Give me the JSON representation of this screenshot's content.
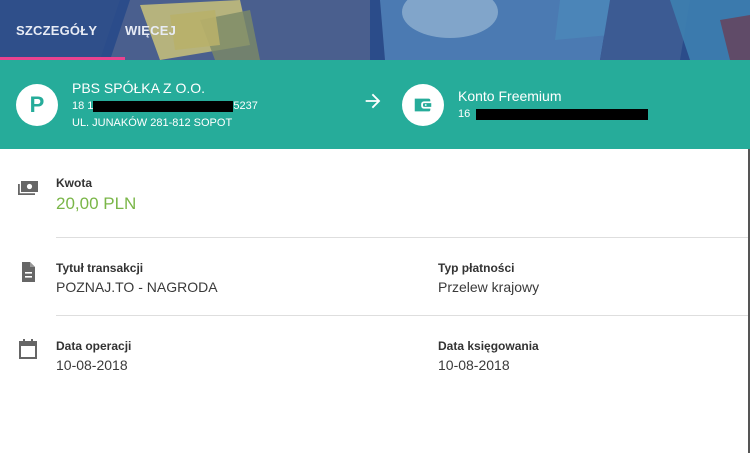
{
  "tabs": [
    {
      "label": "SZCZEGÓŁY",
      "active": true
    },
    {
      "label": "WIĘCEJ",
      "active": false
    }
  ],
  "transfer": {
    "from": {
      "avatar_letter": "P",
      "name": "PBS SPÓŁKA Z O.O.",
      "account_prefix": "18 1",
      "account_suffix": "5237",
      "address": "UL. JUNAKÓW 281-812 SOPOT"
    },
    "to": {
      "name": "Konto Freemium",
      "account_prefix": "16",
      "icon": "wallet-icon"
    },
    "arrow_icon": "arrow-right-icon"
  },
  "details": {
    "amount": {
      "label": "Kwota",
      "value": "20,00 PLN",
      "icon": "money-icon"
    },
    "title": {
      "label": "Tytuł transakcji",
      "value": "POZNAJ.TO - NAGRODA",
      "icon": "document-icon"
    },
    "payment_type": {
      "label": "Typ płatności",
      "value": "Przelew krajowy"
    },
    "operation_date": {
      "label": "Data operacji",
      "value": "10-08-2018",
      "icon": "calendar-icon"
    },
    "posting_date": {
      "label": "Data księgowania",
      "value": "10-08-2018"
    }
  },
  "colors": {
    "banner": "#2a4a86",
    "teal": "#26ac9a",
    "tab_indicator": "#e9438f",
    "amount": "#7ab648"
  }
}
